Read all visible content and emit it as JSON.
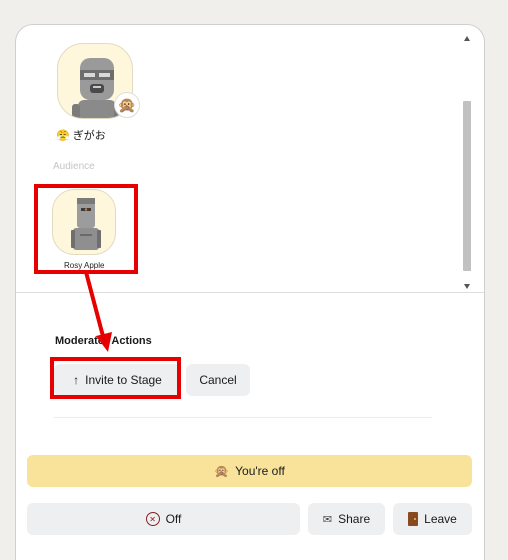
{
  "stage": {
    "speaker": {
      "name": "ぎがお",
      "status_emoji": "😤",
      "badge_emoji": "🙊"
    },
    "audience_label": "Audience",
    "audience": [
      {
        "name": "Rosy Apple"
      }
    ]
  },
  "moderator": {
    "title": "Moderator Actions",
    "invite_icon": "↑",
    "invite_label": "Invite to Stage",
    "cancel_label": "Cancel"
  },
  "controls": {
    "status_emoji": "🙊",
    "status_label": "You're off",
    "mic_label": "Off",
    "share_label": "Share",
    "leave_label": "Leave"
  },
  "icons": {
    "mic": "muted-speaker-icon",
    "share": "mail-icon",
    "leave": "door-icon"
  },
  "colors": {
    "highlight": "#e60000",
    "status_bar": "#f9e39a",
    "avatar_bg": "#fff7dc"
  }
}
